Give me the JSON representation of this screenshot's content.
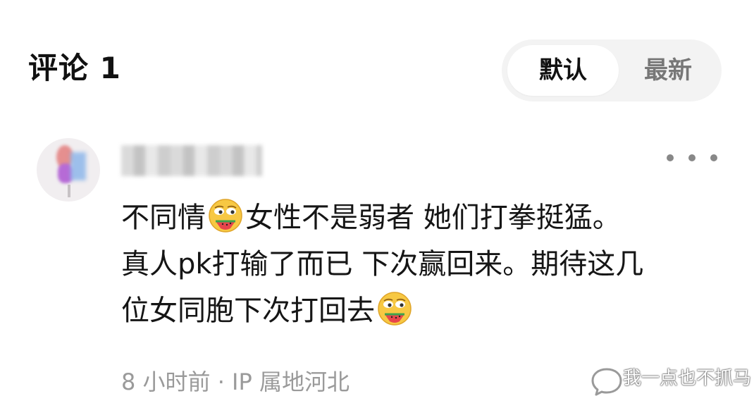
{
  "header": {
    "title": "评论 1"
  },
  "sort": {
    "options": [
      "默认",
      "最新"
    ],
    "selected": "默认"
  },
  "comment": {
    "lines": [
      [
        "不同情",
        "EMOJI",
        "女性不是弱者 她们打拳挺猛。"
      ],
      [
        "真人pk打输了而已 下次赢回来。期待这几"
      ],
      [
        "位女同胞下次打回去",
        "EMOJI"
      ]
    ],
    "line1_a": "不同情",
    "line1_b": "女性不是弱者 她们打拳挺猛。",
    "line2": "真人pk打输了而已 下次赢回来。期待这几",
    "line3": "位女同胞下次打回去",
    "emoji_icon": "watermelon-eating-emoji-icon",
    "meta": "8 小时前 · IP 属地河北"
  },
  "watermark": "我一点也不抓马",
  "colors": {
    "toggle_bg": "#f3f3f3",
    "meta_text": "#9a9a9a",
    "emoji_face": "#f7c843"
  }
}
